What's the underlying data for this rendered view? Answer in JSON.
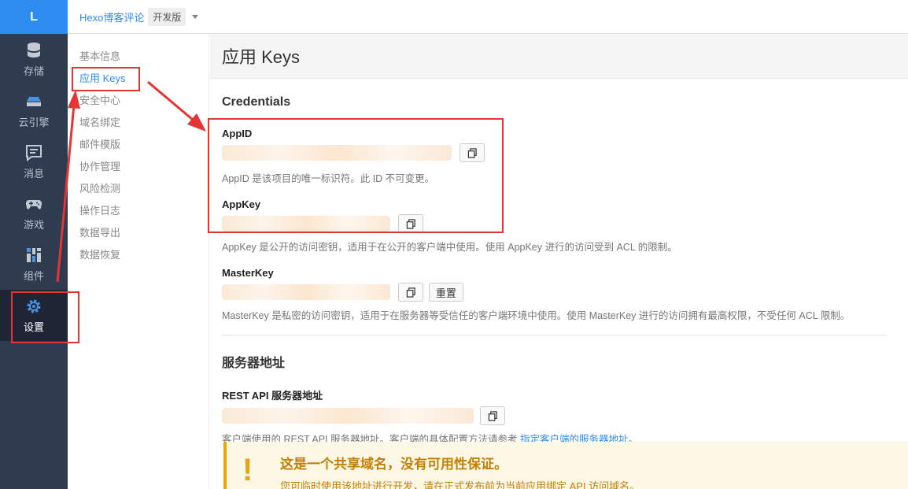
{
  "nav": {
    "logo": "L",
    "items": [
      {
        "label": "存储",
        "icon": "database-icon"
      },
      {
        "label": "云引擎",
        "icon": "cloud-engine-icon"
      },
      {
        "label": "消息",
        "icon": "message-icon"
      },
      {
        "label": "游戏",
        "icon": "gamepad-icon"
      },
      {
        "label": "组件",
        "icon": "components-icon"
      },
      {
        "label": "设置",
        "icon": "gear-icon"
      }
    ]
  },
  "topbar": {
    "app_name": "Hexo博客评论",
    "env_badge": "开发版"
  },
  "submenu": {
    "items": [
      "基本信息",
      "应用 Keys",
      "安全中心",
      "域名绑定",
      "邮件模版",
      "协作管理",
      "风险检测",
      "操作日志",
      "数据导出",
      "数据恢复"
    ]
  },
  "main": {
    "page_title": "应用 Keys",
    "credentials": {
      "title": "Credentials",
      "appid_label": "AppID",
      "appid_help": "AppID 是该项目的唯一标识符。此 ID 不可变更。",
      "appkey_label": "AppKey",
      "appkey_help": "AppKey 是公开的访问密钥，适用于在公开的客户端中使用。使用 AppKey 进行的访问受到 ACL 的限制。",
      "masterkey_label": "MasterKey",
      "reset_label": "重置",
      "masterkey_help": "MasterKey 是私密的访问密钥，适用于在服务器等受信任的客户端环境中使用。使用 MasterKey 进行的访问拥有最高权限，不受任何 ACL 限制。"
    },
    "server": {
      "title": "服务器地址",
      "rest_label": "REST API 服务器地址",
      "rest_help": "客户端使用的 REST API 服务器地址。客户端的具体配置方法请参考",
      "rest_link": "指定客户端的服务器地址",
      "rest_help_end": "。"
    },
    "warning": {
      "icon": "!",
      "title": "这是一个共享域名，没有可用性保证。",
      "subtitle": "您可临时使用该地址进行开发，请在正式发布前为当前应用绑定 API 访问域名。"
    }
  },
  "colors": {
    "accent": "#2d8cf0",
    "nav_bg": "#2f3b4f",
    "annotation": "#e43535",
    "warning": "#e8a317"
  }
}
